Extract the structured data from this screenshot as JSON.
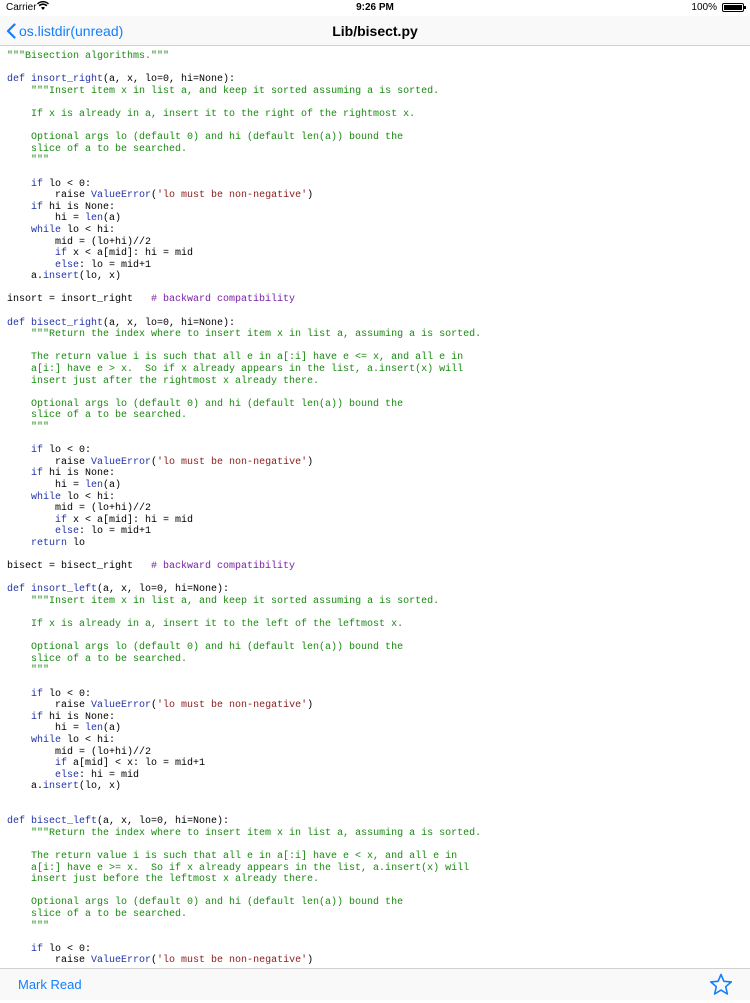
{
  "status": {
    "carrier": "Carrier",
    "time": "9:26 PM",
    "battery": "100%"
  },
  "nav": {
    "back_label": "os.listdir(unread)",
    "title": "Lib/bisect.py"
  },
  "toolbar": {
    "mark_read_label": "Mark Read"
  },
  "code": {
    "lines": [
      [
        [
          "str",
          "\"\"\"Bisection algorithms.\"\"\""
        ]
      ],
      [],
      [
        [
          "kw",
          "def "
        ],
        [
          "cls",
          "insort_right"
        ],
        [
          "",
          "(a, x, lo=0, hi=None):"
        ]
      ],
      [
        [
          "",
          "    "
        ],
        [
          "str",
          "\"\"\"Insert item x in list a, and keep it sorted assuming a is sorted."
        ]
      ],
      [],
      [
        [
          "str",
          "    If x is already in a, insert it to the right of the rightmost x."
        ]
      ],
      [],
      [
        [
          "str",
          "    Optional args lo (default 0) and hi (default len(a)) bound the"
        ]
      ],
      [
        [
          "str",
          "    slice of a to be searched."
        ]
      ],
      [
        [
          "str",
          "    \"\"\""
        ]
      ],
      [],
      [
        [
          "",
          "    "
        ],
        [
          "kw",
          "if"
        ],
        [
          "",
          " lo < 0:"
        ]
      ],
      [
        [
          "",
          "        raise "
        ],
        [
          "cls",
          "ValueError"
        ],
        [
          "",
          "("
        ],
        [
          "errstr",
          "'lo must be non-negative'"
        ],
        [
          "",
          ")"
        ]
      ],
      [
        [
          "",
          "    "
        ],
        [
          "kw",
          "if"
        ],
        [
          "",
          " hi is None:"
        ]
      ],
      [
        [
          "",
          "        hi = "
        ],
        [
          "meth",
          "len"
        ],
        [
          "",
          "(a)"
        ]
      ],
      [
        [
          "",
          "    "
        ],
        [
          "kw",
          "while"
        ],
        [
          "",
          " lo < hi:"
        ]
      ],
      [
        [
          "",
          "        mid = (lo+hi)//2"
        ]
      ],
      [
        [
          "",
          "        "
        ],
        [
          "kw",
          "if"
        ],
        [
          "",
          " x < a[mid]: hi = mid"
        ]
      ],
      [
        [
          "",
          "        "
        ],
        [
          "kw",
          "else"
        ],
        [
          "",
          ": lo = mid+1"
        ]
      ],
      [
        [
          "",
          "    a."
        ],
        [
          "meth",
          "insert"
        ],
        [
          "",
          "(lo, x)"
        ]
      ],
      [],
      [
        [
          "",
          "insort = insort_right   "
        ],
        [
          "cm",
          "# backward compatibility"
        ]
      ],
      [],
      [
        [
          "kw",
          "def "
        ],
        [
          "cls",
          "bisect_right"
        ],
        [
          "",
          "(a, x, lo=0, hi=None):"
        ]
      ],
      [
        [
          "",
          "    "
        ],
        [
          "str",
          "\"\"\"Return the index where to insert item x in list a, assuming a is sorted."
        ]
      ],
      [],
      [
        [
          "str",
          "    The return value i is such that all e in a[:i] have e <= x, and all e in"
        ]
      ],
      [
        [
          "str",
          "    a[i:] have e > x.  So if x already appears in the list, a.insert(x) will"
        ]
      ],
      [
        [
          "str",
          "    insert just after the rightmost x already there."
        ]
      ],
      [],
      [
        [
          "str",
          "    Optional args lo (default 0) and hi (default len(a)) bound the"
        ]
      ],
      [
        [
          "str",
          "    slice of a to be searched."
        ]
      ],
      [
        [
          "str",
          "    \"\"\""
        ]
      ],
      [],
      [
        [
          "",
          "    "
        ],
        [
          "kw",
          "if"
        ],
        [
          "",
          " lo < 0:"
        ]
      ],
      [
        [
          "",
          "        raise "
        ],
        [
          "cls",
          "ValueError"
        ],
        [
          "",
          "("
        ],
        [
          "errstr",
          "'lo must be non-negative'"
        ],
        [
          "",
          ")"
        ]
      ],
      [
        [
          "",
          "    "
        ],
        [
          "kw",
          "if"
        ],
        [
          "",
          " hi is None:"
        ]
      ],
      [
        [
          "",
          "        hi = "
        ],
        [
          "meth",
          "len"
        ],
        [
          "",
          "(a)"
        ]
      ],
      [
        [
          "",
          "    "
        ],
        [
          "kw",
          "while"
        ],
        [
          "",
          " lo < hi:"
        ]
      ],
      [
        [
          "",
          "        mid = (lo+hi)//2"
        ]
      ],
      [
        [
          "",
          "        "
        ],
        [
          "kw",
          "if"
        ],
        [
          "",
          " x < a[mid]: hi = mid"
        ]
      ],
      [
        [
          "",
          "        "
        ],
        [
          "kw",
          "else"
        ],
        [
          "",
          ": lo = mid+1"
        ]
      ],
      [
        [
          "",
          "    "
        ],
        [
          "kw",
          "return"
        ],
        [
          "",
          " lo"
        ]
      ],
      [],
      [
        [
          "",
          "bisect = bisect_right   "
        ],
        [
          "cm",
          "# backward compatibility"
        ]
      ],
      [],
      [
        [
          "kw",
          "def "
        ],
        [
          "cls",
          "insort_left"
        ],
        [
          "",
          "(a, x, lo=0, hi=None):"
        ]
      ],
      [
        [
          "",
          "    "
        ],
        [
          "str",
          "\"\"\"Insert item x in list a, and keep it sorted assuming a is sorted."
        ]
      ],
      [],
      [
        [
          "str",
          "    If x is already in a, insert it to the left of the leftmost x."
        ]
      ],
      [],
      [
        [
          "str",
          "    Optional args lo (default 0) and hi (default len(a)) bound the"
        ]
      ],
      [
        [
          "str",
          "    slice of a to be searched."
        ]
      ],
      [
        [
          "str",
          "    \"\"\""
        ]
      ],
      [],
      [
        [
          "",
          "    "
        ],
        [
          "kw",
          "if"
        ],
        [
          "",
          " lo < 0:"
        ]
      ],
      [
        [
          "",
          "        raise "
        ],
        [
          "cls",
          "ValueError"
        ],
        [
          "",
          "("
        ],
        [
          "errstr",
          "'lo must be non-negative'"
        ],
        [
          "",
          ")"
        ]
      ],
      [
        [
          "",
          "    "
        ],
        [
          "kw",
          "if"
        ],
        [
          "",
          " hi is None:"
        ]
      ],
      [
        [
          "",
          "        hi = "
        ],
        [
          "meth",
          "len"
        ],
        [
          "",
          "(a)"
        ]
      ],
      [
        [
          "",
          "    "
        ],
        [
          "kw",
          "while"
        ],
        [
          "",
          " lo < hi:"
        ]
      ],
      [
        [
          "",
          "        mid = (lo+hi)//2"
        ]
      ],
      [
        [
          "",
          "        "
        ],
        [
          "kw",
          "if"
        ],
        [
          "",
          " a[mid] < x: lo = mid+1"
        ]
      ],
      [
        [
          "",
          "        "
        ],
        [
          "kw",
          "else"
        ],
        [
          "",
          ": hi = mid"
        ]
      ],
      [
        [
          "",
          "    a."
        ],
        [
          "meth",
          "insert"
        ],
        [
          "",
          "(lo, x)"
        ]
      ],
      [],
      [],
      [
        [
          "kw",
          "def "
        ],
        [
          "cls",
          "bisect_left"
        ],
        [
          "",
          "(a, x, lo=0, hi=None):"
        ]
      ],
      [
        [
          "",
          "    "
        ],
        [
          "str",
          "\"\"\"Return the index where to insert item x in list a, assuming a is sorted."
        ]
      ],
      [],
      [
        [
          "str",
          "    The return value i is such that all e in a[:i] have e < x, and all e in"
        ]
      ],
      [
        [
          "str",
          "    a[i:] have e >= x.  So if x already appears in the list, a.insert(x) will"
        ]
      ],
      [
        [
          "str",
          "    insert just before the leftmost x already there."
        ]
      ],
      [],
      [
        [
          "str",
          "    Optional args lo (default 0) and hi (default len(a)) bound the"
        ]
      ],
      [
        [
          "str",
          "    slice of a to be searched."
        ]
      ],
      [
        [
          "str",
          "    \"\"\""
        ]
      ],
      [],
      [
        [
          "",
          "    "
        ],
        [
          "kw",
          "if"
        ],
        [
          "",
          " lo < 0:"
        ]
      ],
      [
        [
          "",
          "        raise "
        ],
        [
          "cls",
          "ValueError"
        ],
        [
          "",
          "("
        ],
        [
          "errstr",
          "'lo must be non-negative'"
        ],
        [
          "",
          ")"
        ]
      ]
    ]
  }
}
